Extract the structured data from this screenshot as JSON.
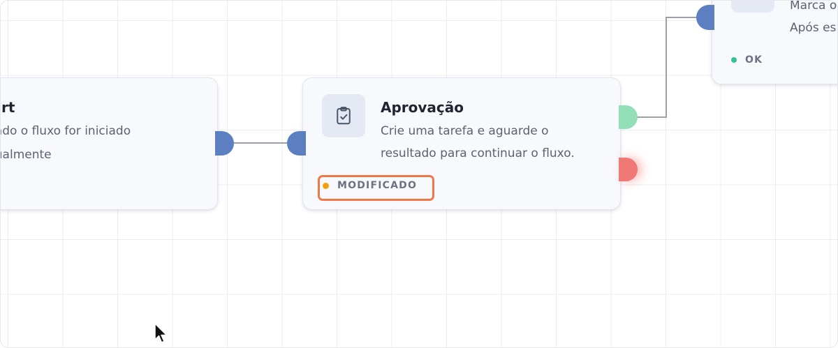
{
  "nodes": {
    "start": {
      "title": "rt",
      "description_line1": "ando o fluxo for iniciado",
      "description_line2": "nualmente"
    },
    "approval": {
      "icon": "clipboard-check-icon",
      "title": "Aprovação",
      "description_line1": "Crie uma tarefa e aguarde o",
      "description_line2": "resultado para continuar o fluxo.",
      "status": "MODIFICADO",
      "status_color": "#f59e0b"
    },
    "ok_branch": {
      "description_line1": "Marca o",
      "description_line2": "Após es",
      "status": "OK",
      "status_color": "#34c38f"
    }
  },
  "colors": {
    "handle_default": "#5b7fc1",
    "handle_success": "#93dfb8",
    "handle_failure": "#f07876",
    "highlight": "#f07746",
    "edge": "#9a9fa8"
  }
}
